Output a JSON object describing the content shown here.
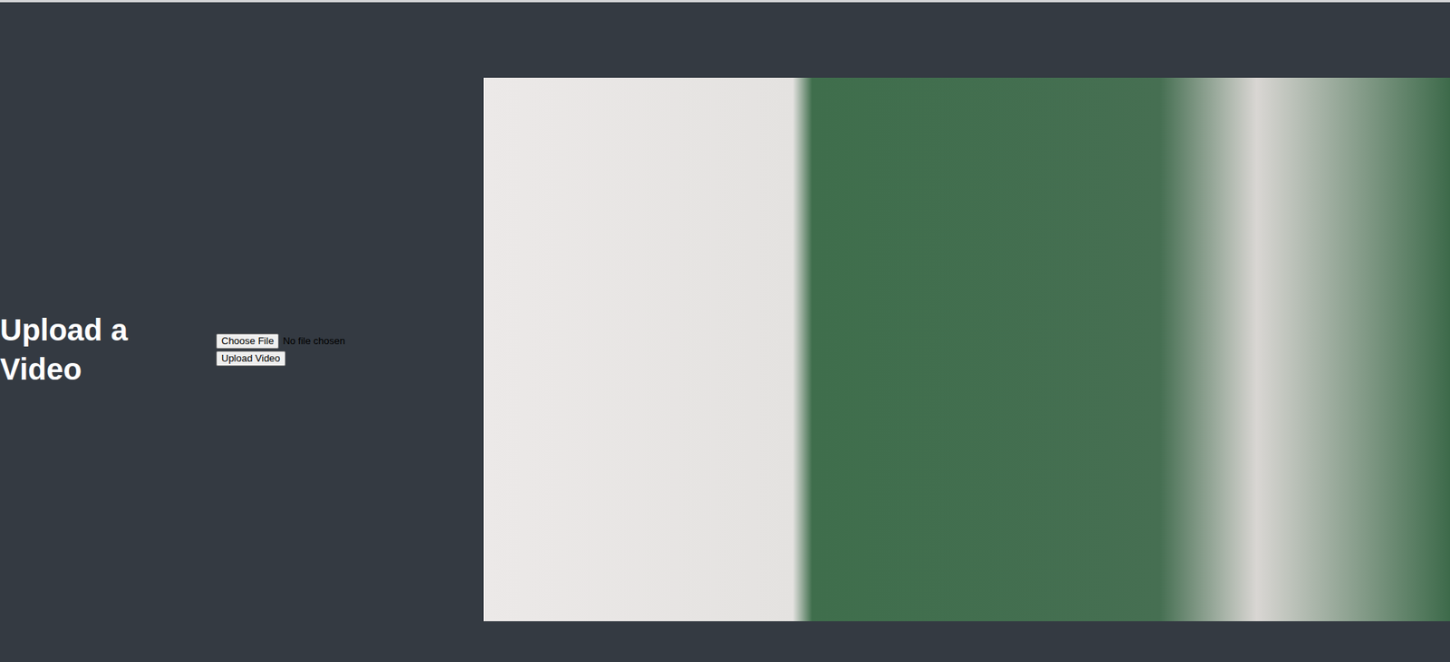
{
  "page": {
    "heading": "Upload a Video"
  },
  "file_input": {
    "button": "Choose File",
    "status": "No file chosen"
  },
  "upload_button": {
    "label": "Upload Video"
  }
}
